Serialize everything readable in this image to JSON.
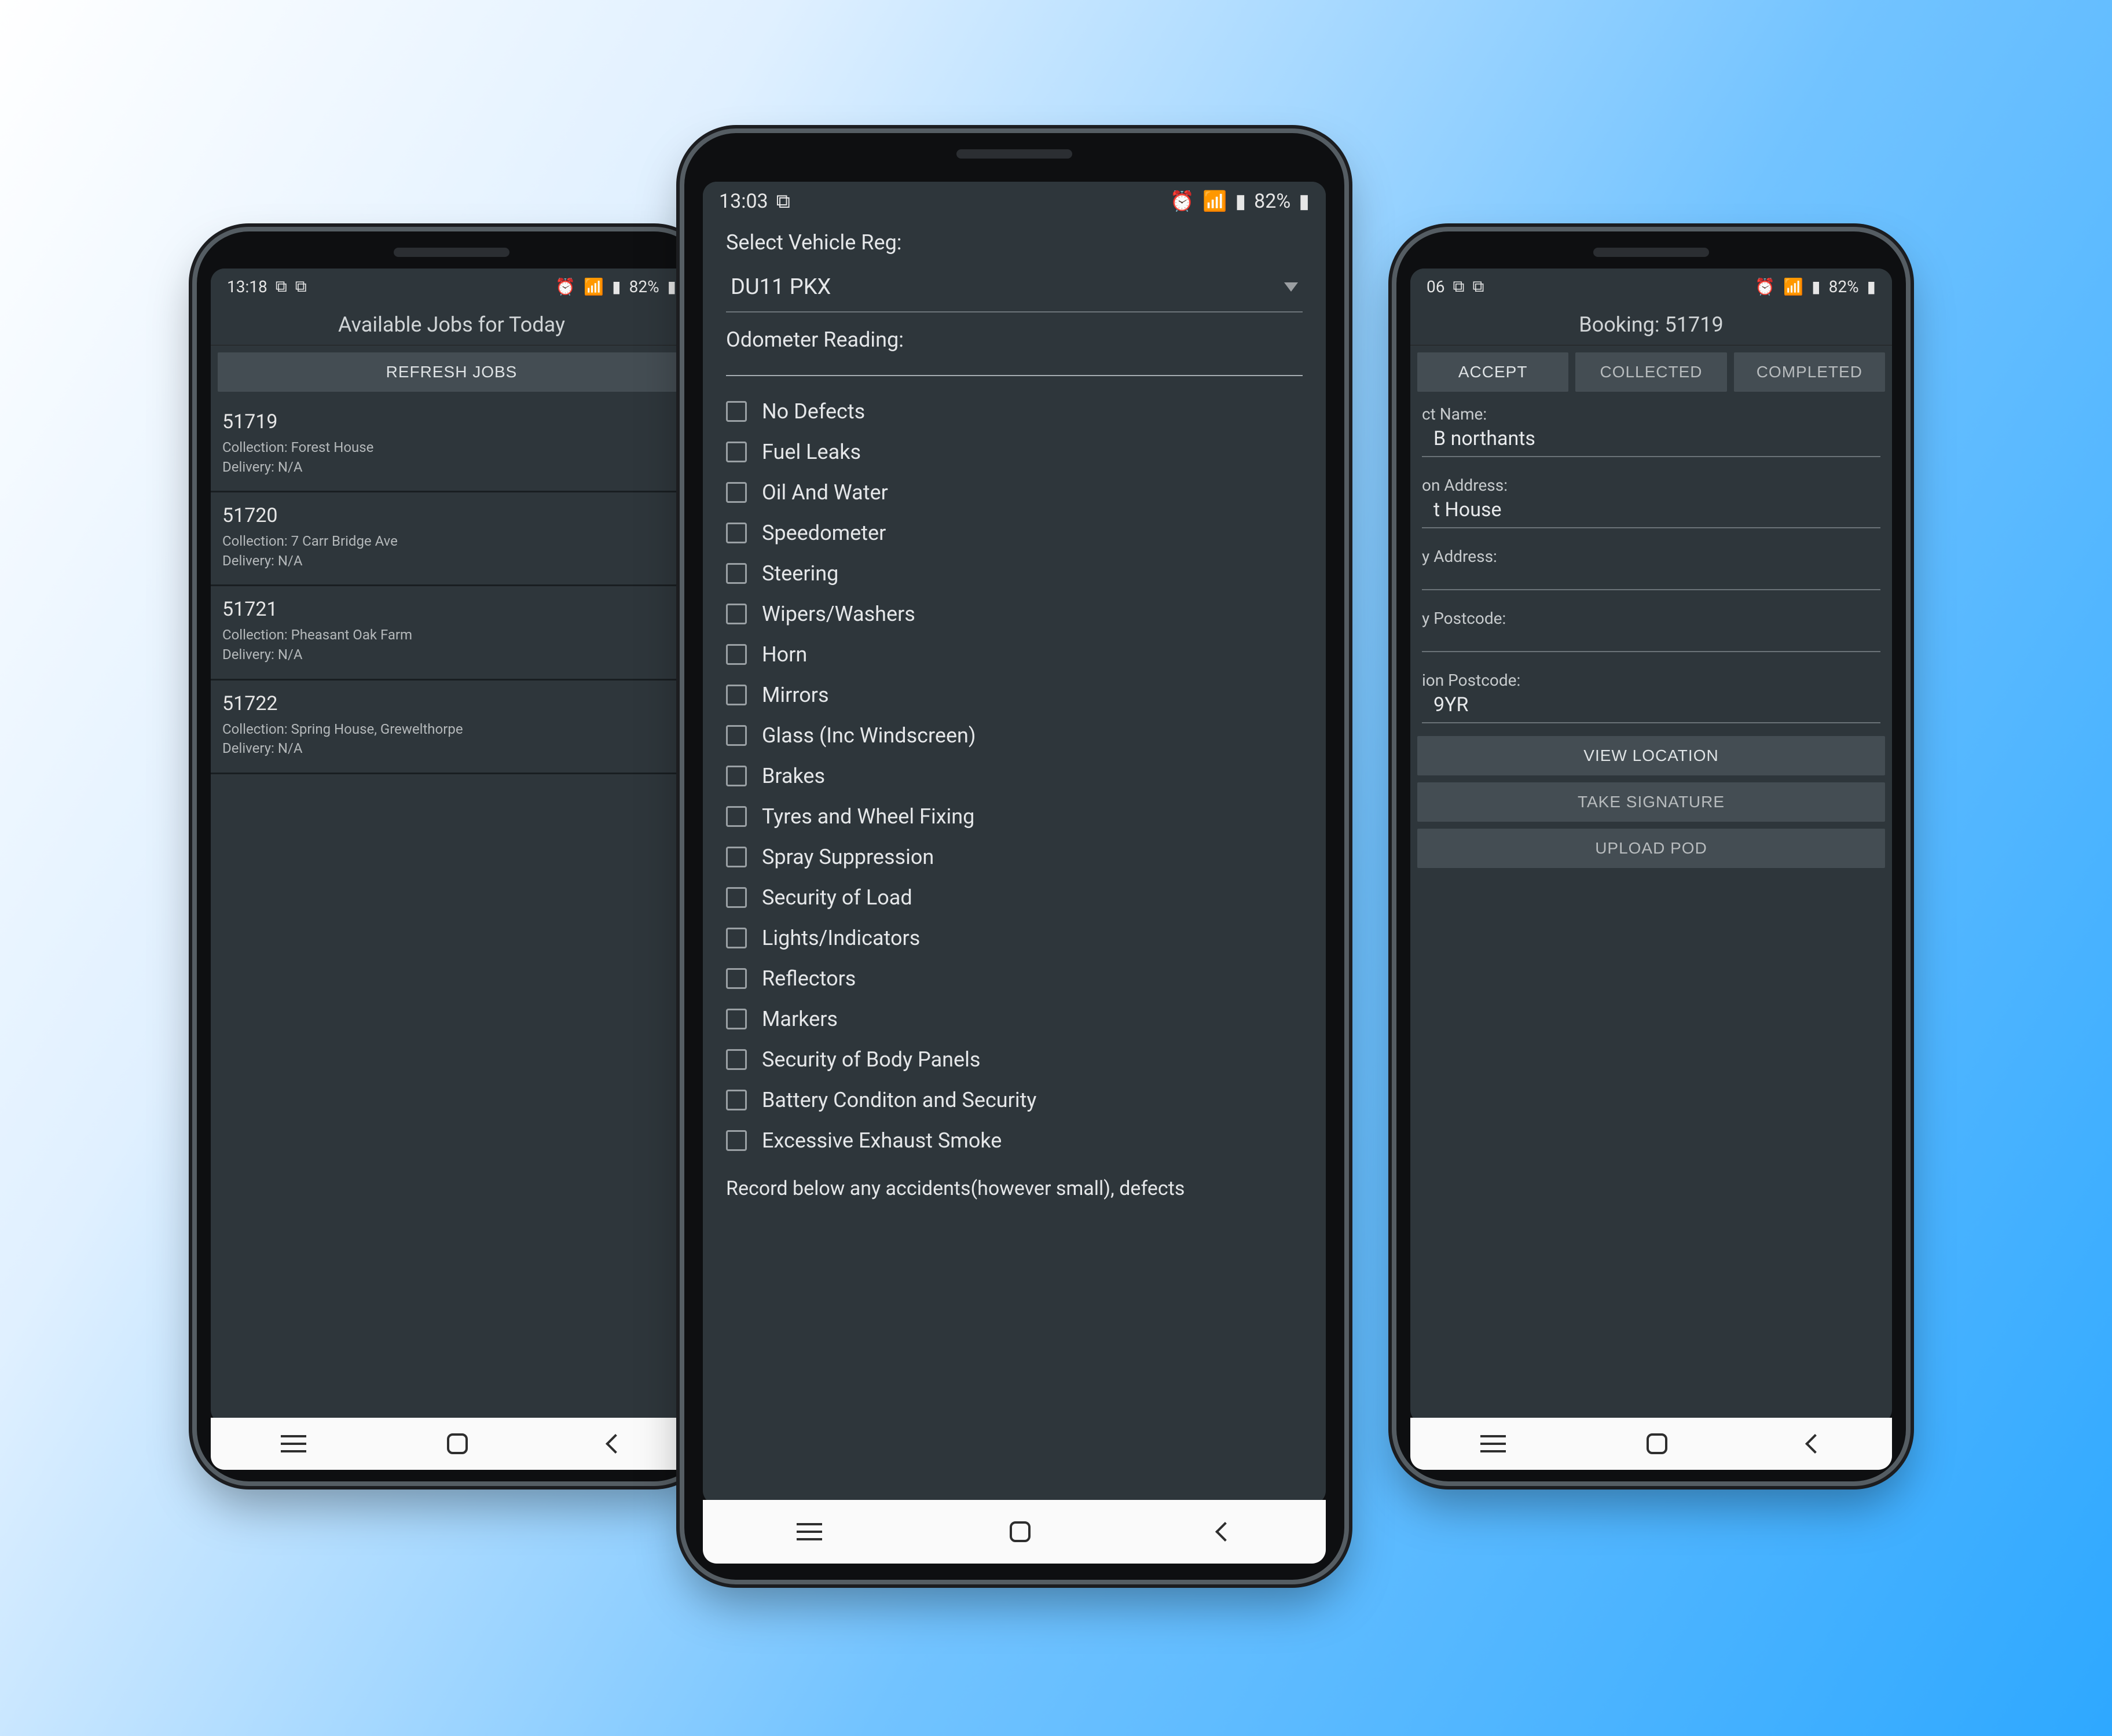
{
  "left": {
    "statusbar": {
      "time": "13:18",
      "battery": "82%"
    },
    "title": "Available Jobs for Today",
    "refresh_label": "REFRESH JOBS",
    "jobs": [
      {
        "id": "51719",
        "collection": "Collection: Forest House",
        "delivery": "Delivery:  N/A"
      },
      {
        "id": "51720",
        "collection": "Collection: 7 Carr Bridge Ave",
        "delivery": "Delivery:  N/A"
      },
      {
        "id": "51721",
        "collection": "Collection: Pheasant Oak Farm",
        "delivery": "Delivery:  N/A"
      },
      {
        "id": "51722",
        "collection": "Collection: Spring House, Grewelthorpe",
        "delivery": "Delivery:  N/A"
      }
    ]
  },
  "center": {
    "statusbar": {
      "time": "13:03",
      "battery": "82%"
    },
    "select_label": "Select Vehicle Reg:",
    "vehicle_reg": "DU11 PKX",
    "odometer_label": "Odometer Reading:",
    "checks": [
      "No Defects",
      "Fuel Leaks",
      "Oil And Water",
      "Speedometer",
      "Steering",
      "Wipers/Washers",
      "Horn",
      "Mirrors",
      "Glass (Inc Windscreen)",
      "Brakes",
      "Tyres and Wheel Fixing",
      "Spray Suppression",
      "Security of Load",
      "Lights/Indicators",
      "Reflectors",
      "Markers",
      "Security of Body Panels",
      "Battery Conditon and Security",
      "Excessive Exhaust Smoke"
    ],
    "footnote": "Record below any accidents(however small), defects"
  },
  "right": {
    "statusbar": {
      "time": "06",
      "battery": "82%"
    },
    "title": "Booking: 51719",
    "buttons": {
      "accept": "ACCEPT",
      "collected": "COLLECTED",
      "completed": "COMPLETED"
    },
    "fields": {
      "contact_name_label": "ct Name:",
      "contact_name": "B northants",
      "collection_address_label": "on Address:",
      "collection_address": "t House",
      "delivery_address_label": "y Address:",
      "delivery_address": "",
      "delivery_postcode_label": "y Postcode:",
      "delivery_postcode": "",
      "collection_postcode_label": "ion Postcode:",
      "collection_postcode": "9YR"
    },
    "actions": {
      "view_location": "VIEW LOCATION",
      "take_signature": "TAKE SIGNATURE",
      "upload_pod": "UPLOAD POD"
    }
  }
}
